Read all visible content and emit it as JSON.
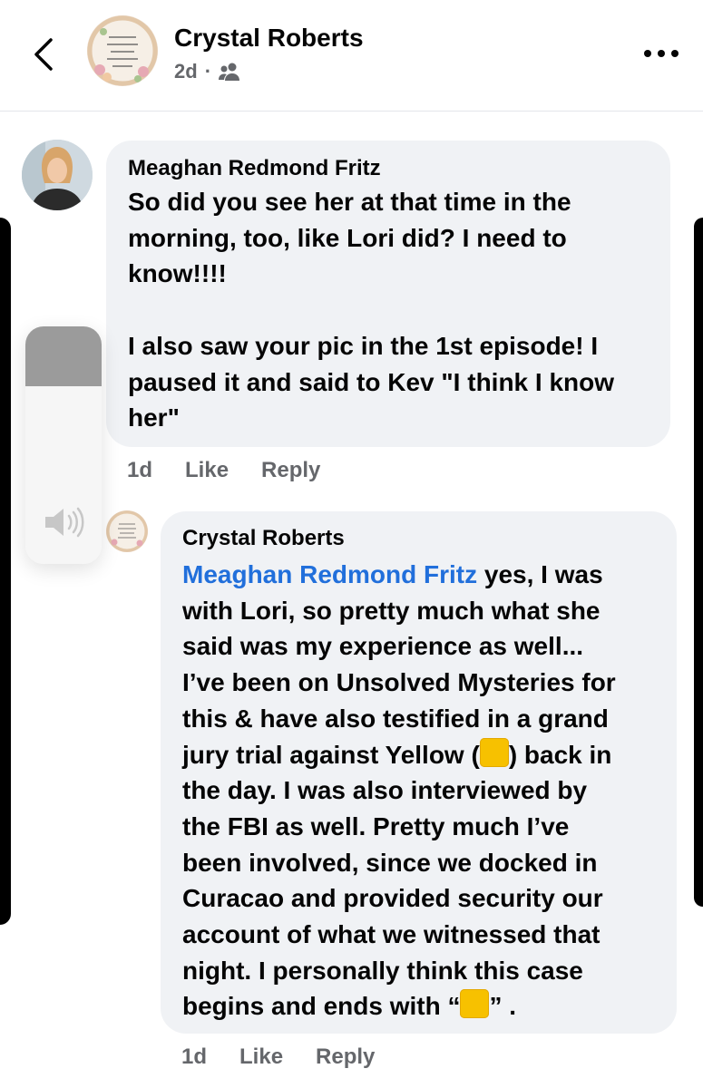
{
  "header": {
    "back_icon": "chevron-left-icon",
    "name": "Crystal Roberts",
    "time": "2d",
    "separator": "·",
    "audience_icon": "friends-icon",
    "more_icon": "more-horizontal-icon"
  },
  "comment1": {
    "author": "Meaghan Redmond Fritz",
    "lines": [
      "So did you see her at that time in the",
      "morning, too, like Lori did? I need to",
      "know!!!!",
      "",
      "I also saw your pic in the 1st episode!  I",
      "paused it and said to Kev \"I think I know",
      "her\""
    ],
    "time": "1d",
    "like_label": "Like",
    "reply_label": "Reply"
  },
  "comment2": {
    "author": "Crystal Roberts",
    "mention": "Meaghan Redmond Fritz",
    "line1_rest": " yes, I was",
    "lines": [
      "with Lori, so pretty much what she",
      "said was my experience as well...",
      "I’ve been on Unsolved Mysteries for",
      "this & have also testified in a grand"
    ],
    "line6_before": "jury trial against Yellow (",
    "line6_after": ") back in",
    "lines_b": [
      "the day.  I was also interviewed by",
      "the FBI as well.  Pretty much I’ve",
      "been involved, since we docked in",
      "Curacao and provided security our",
      "account of what we witnessed that",
      "night.  I personally think this case"
    ],
    "last_before": "begins and ends with “",
    "last_after": "” .",
    "time": "1d",
    "like_label": "Like",
    "reply_label": "Reply"
  },
  "volume_hud": {
    "level": 0.25,
    "icon": "speaker-volume-icon"
  },
  "colors": {
    "bubble": "#f0f2f5",
    "mention": "#216fdb",
    "muted": "#65676b",
    "emoji": "#f7c100"
  }
}
